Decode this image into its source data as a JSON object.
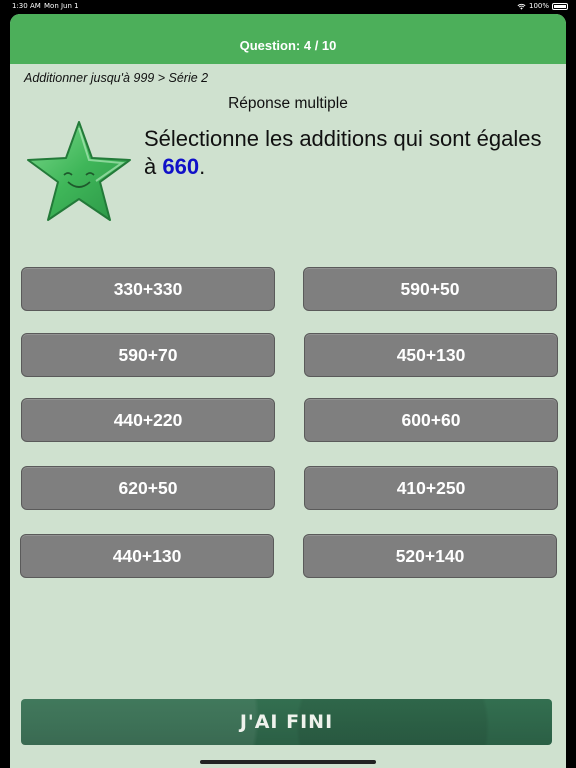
{
  "status_bar": {
    "time": "1:30 AM",
    "date": "Mon Jun 1",
    "battery": "100%"
  },
  "header": {
    "title": "Question: 4 / 10"
  },
  "breadcrumb": "Additionner jusqu'à 999 > Série 2",
  "subtitle": "Réponse multiple",
  "question": {
    "text": "Sélectionne les additions qui sont égales à ",
    "target": "660",
    "suffix": "."
  },
  "choices": [
    "330+330",
    "590+50",
    "590+70",
    "450+130",
    "440+220",
    "600+60",
    "620+50",
    "410+250",
    "440+130",
    "520+140"
  ],
  "finish_button": {
    "label": "J'AI FINI"
  },
  "colors": {
    "header": "#4caf5a",
    "background": "#cfe1cf",
    "choice": "#7f7f7f",
    "target": "#1010c8",
    "finish": "#2f6a4c"
  },
  "icons": [
    "wifi-icon",
    "battery-icon",
    "smiling-star-icon"
  ]
}
